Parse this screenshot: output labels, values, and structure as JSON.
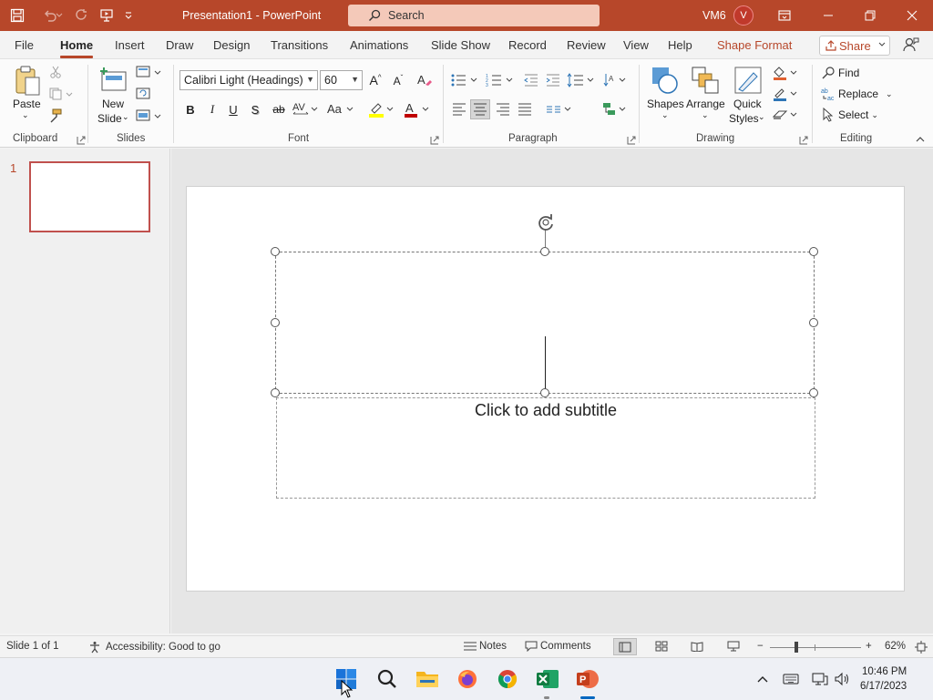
{
  "titlebar": {
    "title": "Presentation1  -  PowerPoint",
    "search_label": "Search",
    "user_initials": "VM6",
    "avatar_letter": "V",
    "accent": "#b7472a"
  },
  "tabs": [
    "File",
    "Home",
    "Insert",
    "Draw",
    "Design",
    "Transitions",
    "Animations",
    "Slide Show",
    "Record",
    "Review",
    "View",
    "Help"
  ],
  "context_tab": "Shape Format",
  "share_label": "Share",
  "ribbon": {
    "clipboard": {
      "paste": "Paste",
      "group": "Clipboard"
    },
    "slides": {
      "new_slide_line1": "New",
      "new_slide_line2": "Slide",
      "group": "Slides"
    },
    "font": {
      "family": "Calibri Light (Headings)",
      "size": "60",
      "group": "Font",
      "bold": "B",
      "italic": "I",
      "underline": "U",
      "shadow": "S",
      "strike": "ab"
    },
    "paragraph": {
      "group": "Paragraph"
    },
    "drawing": {
      "shapes": "Shapes",
      "arrange": "Arrange",
      "quick_line1": "Quick",
      "quick_line2": "Styles",
      "group": "Drawing"
    },
    "editing": {
      "find": "Find",
      "replace": "Replace",
      "select": "Select",
      "group": "Editing"
    }
  },
  "thumbnail": {
    "number": "1"
  },
  "slide": {
    "subtitle_placeholder": "Click to add subtitle"
  },
  "statusbar": {
    "slide_info": "Slide 1 of 1",
    "accessibility": "Accessibility: Good to go",
    "notes": "Notes",
    "comments": "Comments",
    "zoom": "62%",
    "zoom_fraction": 0.62
  },
  "taskbar": {
    "time": "10:46 PM",
    "date": "6/17/2023"
  }
}
